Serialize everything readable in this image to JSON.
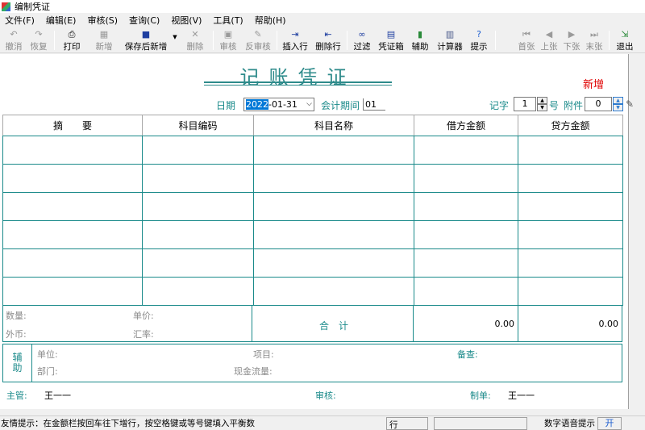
{
  "window": {
    "title": "编制凭证"
  },
  "menu": [
    "文件(F)",
    "编辑(E)",
    "审核(S)",
    "查询(C)",
    "视图(V)",
    "工具(T)",
    "帮助(H)"
  ],
  "toolbar": {
    "undo": "撤消",
    "redo": "恢复",
    "print": "打印",
    "new": "新增",
    "save_new": "保存后新增",
    "delete": "删除",
    "audit": "审核",
    "unaudit": "反审核",
    "insert_row": "插入行",
    "delete_row": "删除行",
    "filter": "过滤",
    "voucher_box": "凭证箱",
    "assist": "辅助",
    "calculator": "计算器",
    "hint": "提示",
    "first": "首张",
    "prev": "上张",
    "next": "下张",
    "last": "末张",
    "exit": "退出"
  },
  "voucher": {
    "title": "记账凭证",
    "status": "新增",
    "date_label": "日期",
    "date_sel": "2022",
    "date_rest": "-01-31",
    "period_label": "会计期间",
    "period": "01",
    "word_label": "记字",
    "number": "1",
    "number_suffix": "号",
    "attachments_label": "附件",
    "attachments": "0"
  },
  "table": {
    "headers": [
      "摘　　要",
      "科目编码",
      "科目名称",
      "借方金额",
      "贷方金额"
    ],
    "row_count": 6
  },
  "summary": {
    "qty_label": "数量:",
    "unit_price_label": "单价:",
    "foreign_label": "外币:",
    "rate_label": "汇率:",
    "total_label": "合　计",
    "debit_total": "0.00",
    "credit_total": "0.00"
  },
  "aux": {
    "tag": "辅助",
    "unit_label": "单位:",
    "dept_label": "部门:",
    "project_label": "项目:",
    "cashflow_label": "现金流量:",
    "remark_label": "备查:"
  },
  "sign": {
    "supervisor_label": "主管:",
    "supervisor": "王一一",
    "auditor_label": "审核:",
    "maker_label": "制单:",
    "maker": "王一一"
  },
  "status": {
    "hint": "友情提示：在金额栏按回车往下增行，按空格键或等号键填入平衡数",
    "row_label": "行",
    "voice_label": "数字语音提示",
    "voice_state": "开"
  },
  "colors": {
    "accent": "#1a8a8a",
    "status_new": "#e00000"
  }
}
